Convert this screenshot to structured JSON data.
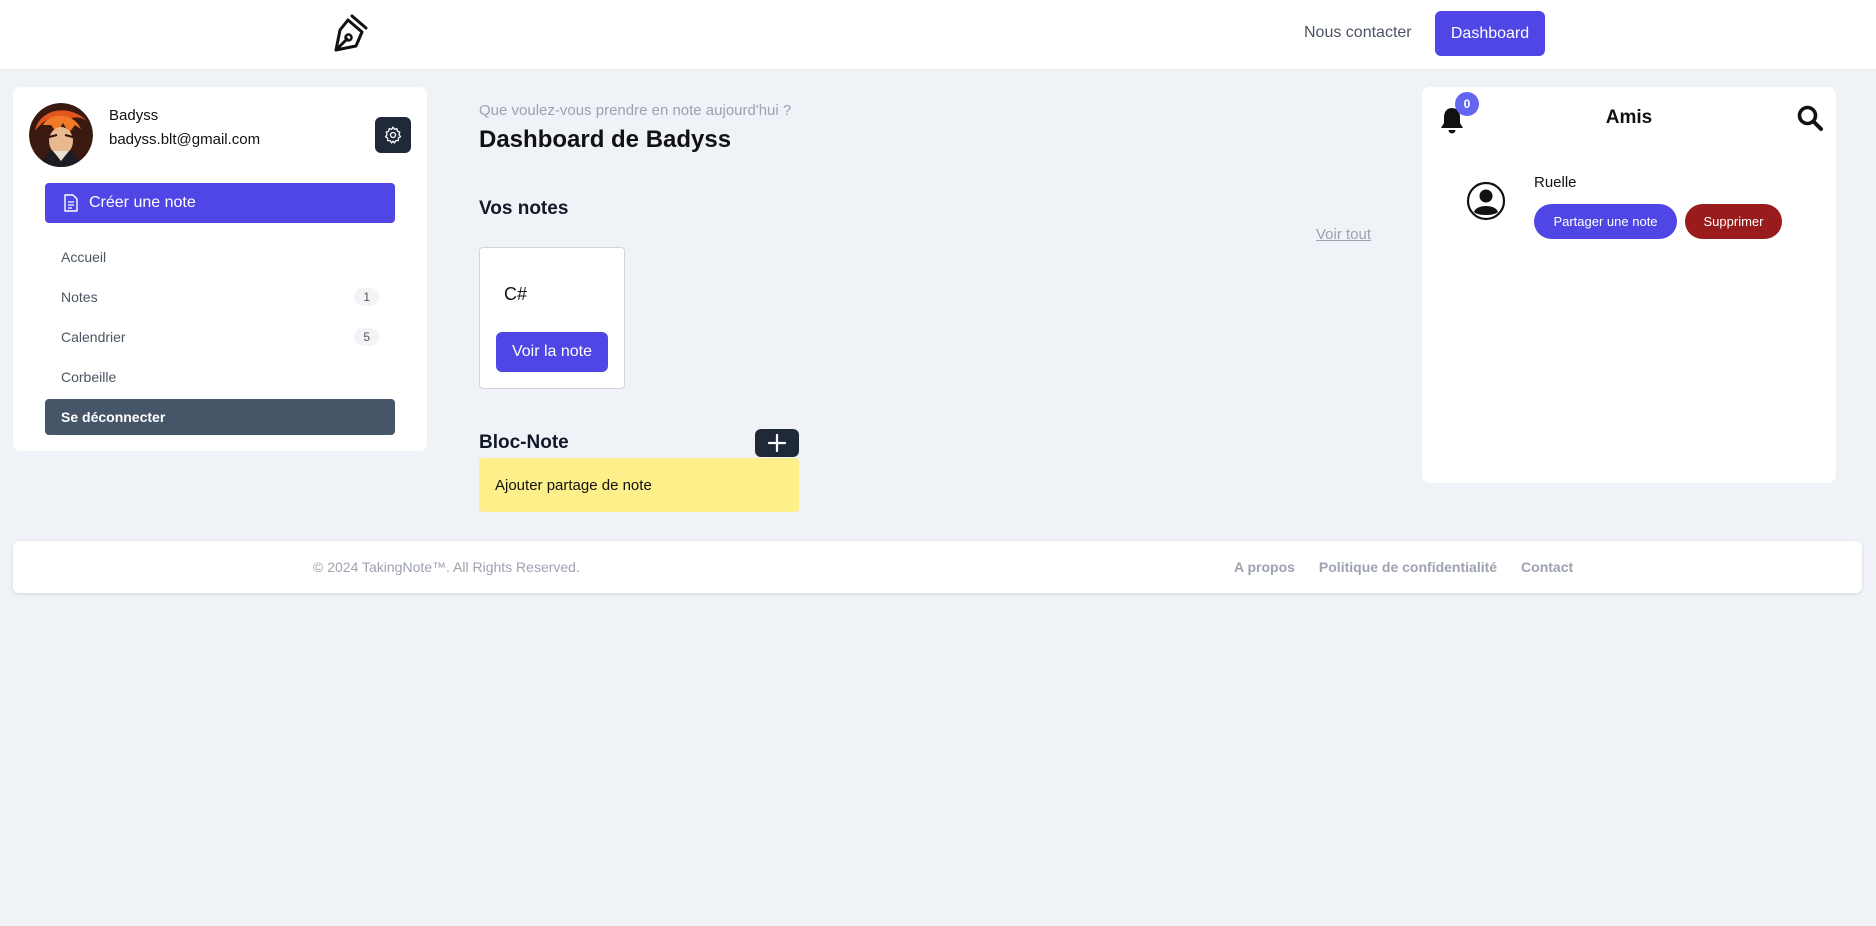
{
  "header": {
    "logo_icon": "pen-nib-icon",
    "contact_label": "Nous contacter",
    "dashboard_label": "Dashboard"
  },
  "user": {
    "name": "Badyss",
    "email": "badyss.blt@gmail.com"
  },
  "sidebar": {
    "create_label": "Créer une note",
    "items": [
      {
        "label": "Accueil",
        "badge": ""
      },
      {
        "label": "Notes",
        "badge": "1"
      },
      {
        "label": "Calendrier",
        "badge": "5"
      },
      {
        "label": "Corbeille",
        "badge": ""
      }
    ],
    "logout_label": "Se déconnecter"
  },
  "main": {
    "subtitle": "Que voulez-vous prendre en note aujourd'hui ?",
    "title": "Dashboard de Badyss",
    "notes_heading": "Vos notes",
    "see_all": "Voir tout",
    "notes": [
      {
        "title": "C#",
        "button": "Voir la note"
      }
    ],
    "bloc_heading": "Bloc-Note",
    "bloc_text": "Ajouter partage de note"
  },
  "friends": {
    "title": "Amis",
    "notification_count": "0",
    "list": [
      {
        "name": "Ruelle",
        "share_label": "Partager une note",
        "delete_label": "Supprimer"
      }
    ]
  },
  "footer": {
    "copyright": "© 2024 TakingNote™. All Rights Reserved.",
    "links": [
      "A propos",
      "Politique de confidentialité",
      "Contact"
    ]
  },
  "colors": {
    "accent": "#4f46e5",
    "danger": "#991b1b",
    "note_yellow": "#fdef8a",
    "background": "#eff2f7"
  }
}
